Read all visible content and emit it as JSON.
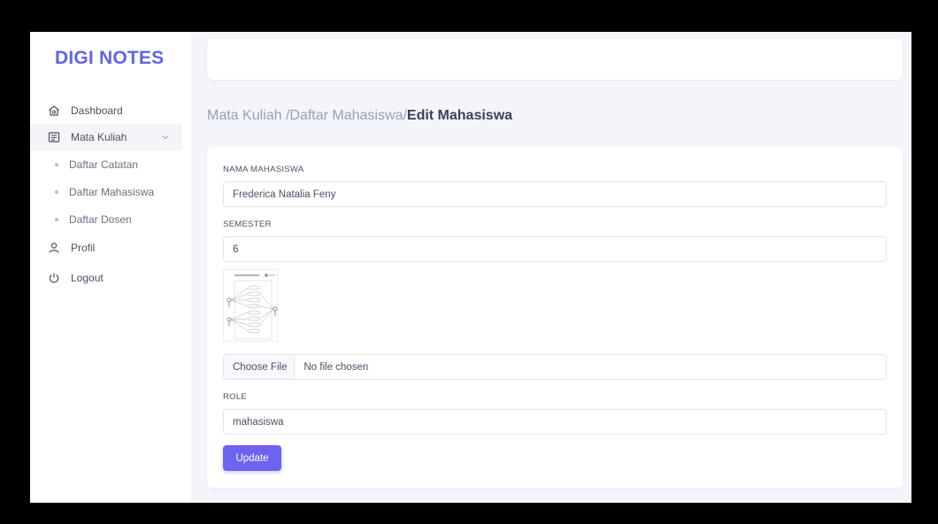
{
  "brand": "DIGI NOTES",
  "sidebar": {
    "items": [
      {
        "label": "Dashboard",
        "icon": "home-icon"
      },
      {
        "label": "Mata Kuliah",
        "icon": "notebook-icon"
      },
      {
        "label": "Profil",
        "icon": "user-icon"
      },
      {
        "label": "Logout",
        "icon": "power-icon"
      }
    ],
    "sub_items": [
      "Daftar Catatan",
      "Daftar Mahasiswa",
      "Daftar Dosen"
    ]
  },
  "breadcrumb": {
    "part1": "Mata Kuliah /",
    "part2": "Daftar Mahasiswa/",
    "current": "Edit Mahasiswa"
  },
  "form": {
    "nama_label": "NAMA MAHASISWA",
    "nama_value": "Frederica Natalia Feny",
    "semester_label": "SEMESTER",
    "semester_value": "6",
    "file_button": "Choose File",
    "file_status": "No file chosen",
    "role_label": "ROLE",
    "role_value": "mahasiswa",
    "submit_label": "Update"
  },
  "colors": {
    "brand": "#5f67e0",
    "accent": "#6c63f0",
    "background": "#f4f5fa"
  }
}
